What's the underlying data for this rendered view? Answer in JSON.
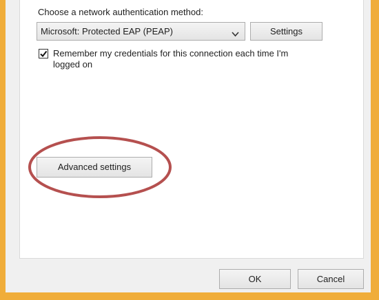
{
  "auth": {
    "method_label": "Choose a network authentication method:",
    "selected_method": "Microsoft: Protected EAP (PEAP)",
    "settings_button": "Settings"
  },
  "credentials": {
    "checked": true,
    "label": "Remember my credentials for this connection each time I'm logged on"
  },
  "advanced": {
    "button_label": "Advanced settings"
  },
  "footer": {
    "ok_label": "OK",
    "cancel_label": "Cancel"
  },
  "colors": {
    "window_border": "#f0ad3a",
    "highlight_ellipse": "#b5504f",
    "dialog_background": "#f0f0f0"
  }
}
